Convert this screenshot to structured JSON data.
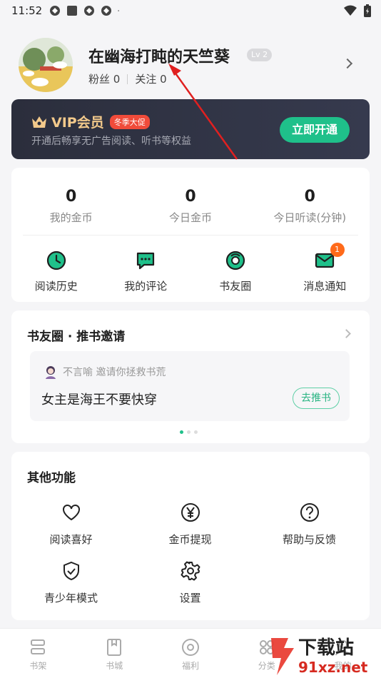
{
  "status": {
    "time": "11:52"
  },
  "profile": {
    "name": "在幽海打盹的天竺葵",
    "level": "Lv 2",
    "fans_label": "粉丝 0",
    "following_label": "关注 0"
  },
  "vip": {
    "title": "VIP会员",
    "tag": "冬季大促",
    "desc": "开通后畅享无广告阅读、听书等权益",
    "button": "立即开通"
  },
  "stats": [
    {
      "value": "0",
      "label": "我的金币"
    },
    {
      "value": "0",
      "label": "今日金币"
    },
    {
      "value": "0",
      "label": "今日听读(分钟)"
    }
  ],
  "quick": [
    {
      "label": "阅读历史",
      "icon": "clock-icon"
    },
    {
      "label": "我的评论",
      "icon": "comment-icon"
    },
    {
      "label": "书友圈",
      "icon": "circle-icon"
    },
    {
      "label": "消息通知",
      "icon": "mail-icon",
      "badge": "1"
    }
  ],
  "invite": {
    "title": "书友圈 · 推书邀请",
    "user_line": "不言喻 邀请你拯救书荒",
    "book": "女主是海王不要快穿",
    "button": "去推书"
  },
  "other": {
    "title": "其他功能",
    "items": [
      {
        "label": "阅读喜好",
        "icon": "heart-icon"
      },
      {
        "label": "金币提现",
        "icon": "yen-icon"
      },
      {
        "label": "帮助与反馈",
        "icon": "help-icon"
      },
      {
        "label": "青少年模式",
        "icon": "shield-icon"
      },
      {
        "label": "设置",
        "icon": "gear-icon"
      }
    ]
  },
  "tabs": [
    {
      "label": "书架",
      "icon": "bookshelf-icon"
    },
    {
      "label": "书城",
      "icon": "book-icon"
    },
    {
      "label": "福利",
      "icon": "gift-icon"
    },
    {
      "label": "分类",
      "icon": "category-icon"
    },
    {
      "label": "我的",
      "icon": "profile-icon"
    }
  ],
  "watermark": {
    "text": "下载站",
    "url_text": "91xz.net"
  },
  "colors": {
    "accent": "#1fc08a",
    "vip_gold": "#f2c98b",
    "badge": "#ff6a1a",
    "vip_bg": "#2b2e3c"
  }
}
